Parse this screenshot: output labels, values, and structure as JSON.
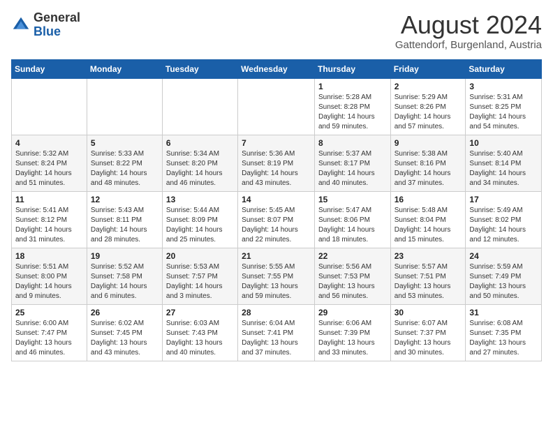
{
  "logo": {
    "general": "General",
    "blue": "Blue"
  },
  "header": {
    "title": "August 2024",
    "subtitle": "Gattendorf, Burgenland, Austria"
  },
  "weekdays": [
    "Sunday",
    "Monday",
    "Tuesday",
    "Wednesday",
    "Thursday",
    "Friday",
    "Saturday"
  ],
  "weeks": [
    [
      {
        "day": "",
        "info": ""
      },
      {
        "day": "",
        "info": ""
      },
      {
        "day": "",
        "info": ""
      },
      {
        "day": "",
        "info": ""
      },
      {
        "day": "1",
        "info": "Sunrise: 5:28 AM\nSunset: 8:28 PM\nDaylight: 14 hours\nand 59 minutes."
      },
      {
        "day": "2",
        "info": "Sunrise: 5:29 AM\nSunset: 8:26 PM\nDaylight: 14 hours\nand 57 minutes."
      },
      {
        "day": "3",
        "info": "Sunrise: 5:31 AM\nSunset: 8:25 PM\nDaylight: 14 hours\nand 54 minutes."
      }
    ],
    [
      {
        "day": "4",
        "info": "Sunrise: 5:32 AM\nSunset: 8:24 PM\nDaylight: 14 hours\nand 51 minutes."
      },
      {
        "day": "5",
        "info": "Sunrise: 5:33 AM\nSunset: 8:22 PM\nDaylight: 14 hours\nand 48 minutes."
      },
      {
        "day": "6",
        "info": "Sunrise: 5:34 AM\nSunset: 8:20 PM\nDaylight: 14 hours\nand 46 minutes."
      },
      {
        "day": "7",
        "info": "Sunrise: 5:36 AM\nSunset: 8:19 PM\nDaylight: 14 hours\nand 43 minutes."
      },
      {
        "day": "8",
        "info": "Sunrise: 5:37 AM\nSunset: 8:17 PM\nDaylight: 14 hours\nand 40 minutes."
      },
      {
        "day": "9",
        "info": "Sunrise: 5:38 AM\nSunset: 8:16 PM\nDaylight: 14 hours\nand 37 minutes."
      },
      {
        "day": "10",
        "info": "Sunrise: 5:40 AM\nSunset: 8:14 PM\nDaylight: 14 hours\nand 34 minutes."
      }
    ],
    [
      {
        "day": "11",
        "info": "Sunrise: 5:41 AM\nSunset: 8:12 PM\nDaylight: 14 hours\nand 31 minutes."
      },
      {
        "day": "12",
        "info": "Sunrise: 5:43 AM\nSunset: 8:11 PM\nDaylight: 14 hours\nand 28 minutes."
      },
      {
        "day": "13",
        "info": "Sunrise: 5:44 AM\nSunset: 8:09 PM\nDaylight: 14 hours\nand 25 minutes."
      },
      {
        "day": "14",
        "info": "Sunrise: 5:45 AM\nSunset: 8:07 PM\nDaylight: 14 hours\nand 22 minutes."
      },
      {
        "day": "15",
        "info": "Sunrise: 5:47 AM\nSunset: 8:06 PM\nDaylight: 14 hours\nand 18 minutes."
      },
      {
        "day": "16",
        "info": "Sunrise: 5:48 AM\nSunset: 8:04 PM\nDaylight: 14 hours\nand 15 minutes."
      },
      {
        "day": "17",
        "info": "Sunrise: 5:49 AM\nSunset: 8:02 PM\nDaylight: 14 hours\nand 12 minutes."
      }
    ],
    [
      {
        "day": "18",
        "info": "Sunrise: 5:51 AM\nSunset: 8:00 PM\nDaylight: 14 hours\nand 9 minutes."
      },
      {
        "day": "19",
        "info": "Sunrise: 5:52 AM\nSunset: 7:58 PM\nDaylight: 14 hours\nand 6 minutes."
      },
      {
        "day": "20",
        "info": "Sunrise: 5:53 AM\nSunset: 7:57 PM\nDaylight: 14 hours\nand 3 minutes."
      },
      {
        "day": "21",
        "info": "Sunrise: 5:55 AM\nSunset: 7:55 PM\nDaylight: 13 hours\nand 59 minutes."
      },
      {
        "day": "22",
        "info": "Sunrise: 5:56 AM\nSunset: 7:53 PM\nDaylight: 13 hours\nand 56 minutes."
      },
      {
        "day": "23",
        "info": "Sunrise: 5:57 AM\nSunset: 7:51 PM\nDaylight: 13 hours\nand 53 minutes."
      },
      {
        "day": "24",
        "info": "Sunrise: 5:59 AM\nSunset: 7:49 PM\nDaylight: 13 hours\nand 50 minutes."
      }
    ],
    [
      {
        "day": "25",
        "info": "Sunrise: 6:00 AM\nSunset: 7:47 PM\nDaylight: 13 hours\nand 46 minutes."
      },
      {
        "day": "26",
        "info": "Sunrise: 6:02 AM\nSunset: 7:45 PM\nDaylight: 13 hours\nand 43 minutes."
      },
      {
        "day": "27",
        "info": "Sunrise: 6:03 AM\nSunset: 7:43 PM\nDaylight: 13 hours\nand 40 minutes."
      },
      {
        "day": "28",
        "info": "Sunrise: 6:04 AM\nSunset: 7:41 PM\nDaylight: 13 hours\nand 37 minutes."
      },
      {
        "day": "29",
        "info": "Sunrise: 6:06 AM\nSunset: 7:39 PM\nDaylight: 13 hours\nand 33 minutes."
      },
      {
        "day": "30",
        "info": "Sunrise: 6:07 AM\nSunset: 7:37 PM\nDaylight: 13 hours\nand 30 minutes."
      },
      {
        "day": "31",
        "info": "Sunrise: 6:08 AM\nSunset: 7:35 PM\nDaylight: 13 hours\nand 27 minutes."
      }
    ]
  ]
}
